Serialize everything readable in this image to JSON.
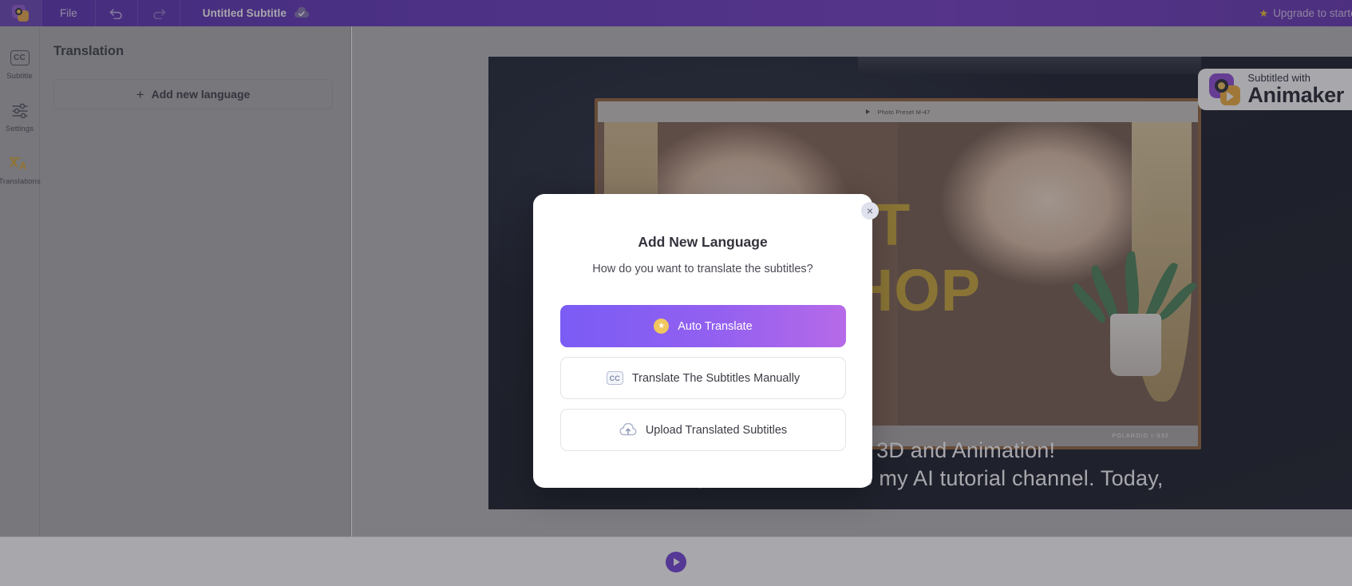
{
  "topbar": {
    "logo_icon": "animaker-logo-icon",
    "file_menu": "File",
    "undo_icon": "undo-icon",
    "redo_icon": "redo-icon",
    "project_title": "Untitled Subtitle",
    "saved_icon": "cloud-saved-icon",
    "upgrade_label": "Upgrade to starter",
    "upgrade_star_icon": "star-icon"
  },
  "rail": {
    "items": [
      {
        "label": "Subtitle",
        "icon": "cc-icon",
        "glyph": "CC"
      },
      {
        "label": "Settings",
        "icon": "sliders-icon"
      },
      {
        "label": "Translations",
        "icon": "translate-icon"
      }
    ]
  },
  "panel": {
    "title": "Translation",
    "add_language_label": "Add new language",
    "add_language_icon": "plus-icon"
  },
  "video": {
    "window_bar_text": "Photo Preset  M-47",
    "window_play_icon": "play-icon",
    "footer_text": "POLAROID   I-S32",
    "headline_line1": "NOT",
    "headline_line2": "TOSHOP",
    "subtitle_line1": "ge about 3D and Animation!",
    "subtitle_line2": "Hi, welcome back to my AI tutorial channel. Today,"
  },
  "watermark": {
    "subtitled_with": "Subtitled with",
    "brand": "Animaker",
    "logo_icon": "animaker-logo-icon"
  },
  "bottombar": {
    "play_icon": "play-icon"
  },
  "modal": {
    "close_icon": "close-icon",
    "close_glyph": "×",
    "title": "Add New Language",
    "subtitle": "How do you want to translate the subtitles?",
    "options": [
      {
        "label": "Auto Translate",
        "icon": "star-badge-icon",
        "style": "primary"
      },
      {
        "label": "Translate The Subtitles Manually",
        "icon": "cc-icon",
        "style": "outline"
      },
      {
        "label": "Upload Translated Subtitles",
        "icon": "cloud-upload-icon",
        "style": "outline"
      }
    ]
  },
  "colors": {
    "topbar_purple": "#5a29b8",
    "panel_gray": "#a8a8a8",
    "accent_gradient_start": "#7a5cf5",
    "accent_gradient_end": "#b66ae8",
    "headline_gold": "#c9a227",
    "play_purple": "#6b34d6"
  }
}
